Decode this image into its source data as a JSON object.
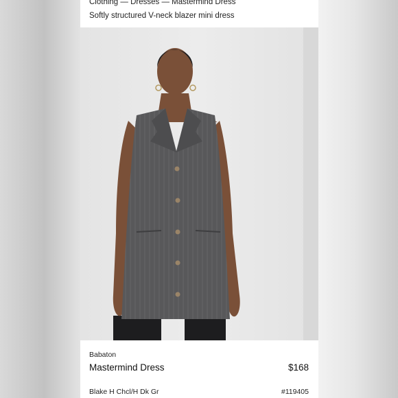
{
  "header": {
    "breadcrumb": "Clothing — Dresses — Mastermind Dress",
    "subtitle": "Softly structured V-neck blazer mini dress"
  },
  "product": {
    "brand": "Babaton",
    "name": "Mastermind Dress",
    "price": "$168",
    "color": "Blake H Chcl/H Dk Gr",
    "sku": "#119405"
  },
  "colors": {
    "dress": "#58585a",
    "background": "#e9e9e9",
    "card": "#ffffff"
  }
}
